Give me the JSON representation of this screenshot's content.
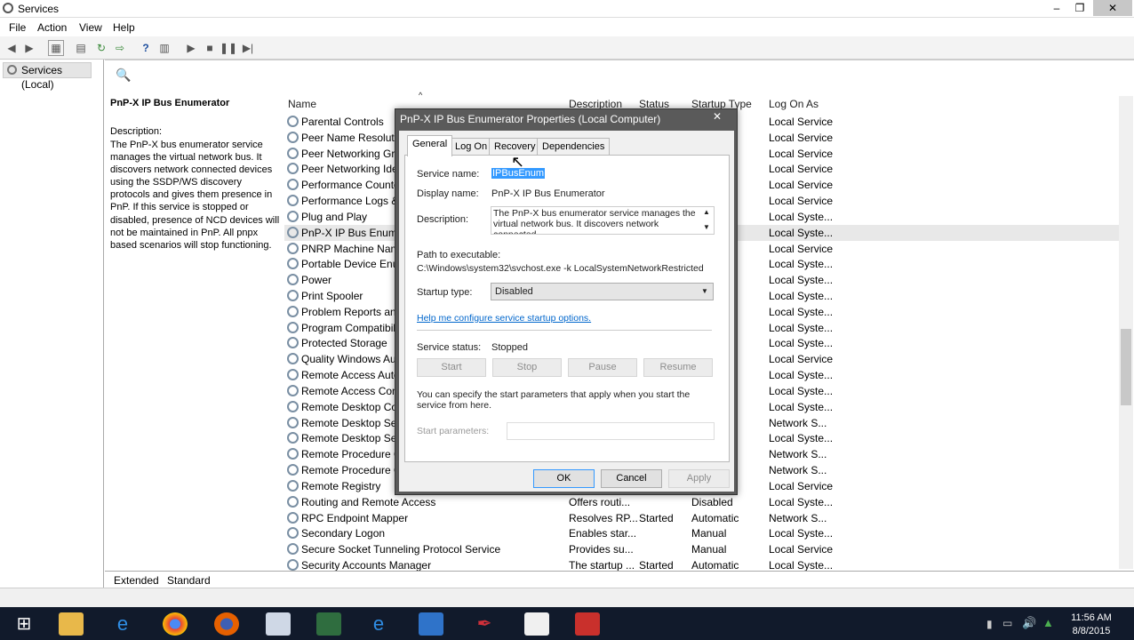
{
  "window": {
    "title": "Services",
    "min": "–",
    "max": "❐",
    "close": "✕"
  },
  "menu": [
    "File",
    "Action",
    "View",
    "Help"
  ],
  "tree": {
    "node": "Services (Local)"
  },
  "detail": {
    "title": "PnP-X IP Bus Enumerator",
    "desc_label": "Description:",
    "desc": "The PnP-X bus enumerator service manages the virtual network bus. It discovers network connected devices using the SSDP/WS discovery protocols and gives them presence in PnP. If this service is stopped or disabled, presence of NCD devices will not be maintained in PnP. All pnpx based scenarios will stop functioning."
  },
  "columns": {
    "name": "Name",
    "description": "Description",
    "status": "Status",
    "startup": "Startup Type",
    "logon": "Log On As"
  },
  "rows": [
    {
      "name": "Parental Controls",
      "desc": "",
      "status": "",
      "startup": "",
      "logon": "Local Service"
    },
    {
      "name": "Peer Name Resolutio",
      "desc": "",
      "status": "",
      "startup": "",
      "logon": "Local Service"
    },
    {
      "name": "Peer Networking Gro",
      "desc": "",
      "status": "",
      "startup": "",
      "logon": "Local Service"
    },
    {
      "name": "Peer Networking Ider",
      "desc": "",
      "status": "",
      "startup": "",
      "logon": "Local Service"
    },
    {
      "name": "Performance Counte",
      "desc": "",
      "status": "",
      "startup": "",
      "logon": "Local Service"
    },
    {
      "name": "Performance Logs &",
      "desc": "",
      "status": "",
      "startup": "",
      "logon": "Local Service"
    },
    {
      "name": "Plug and Play",
      "desc": "",
      "status": "",
      "startup": "",
      "logon": "Local Syste..."
    },
    {
      "name": "PnP-X IP Bus Enumer",
      "desc": "",
      "status": "",
      "startup": "",
      "logon": "Local Syste..."
    },
    {
      "name": "PNRP Machine Name",
      "desc": "",
      "status": "",
      "startup": "",
      "logon": "Local Service"
    },
    {
      "name": "Portable Device Enur",
      "desc": "",
      "status": "",
      "startup": "",
      "logon": "Local Syste..."
    },
    {
      "name": "Power",
      "desc": "",
      "status": "",
      "startup": "",
      "logon": "Local Syste..."
    },
    {
      "name": "Print Spooler",
      "desc": "",
      "status": "",
      "startup": "",
      "logon": "Local Syste..."
    },
    {
      "name": "Problem Reports and",
      "desc": "",
      "status": "",
      "startup": "",
      "logon": "Local Syste..."
    },
    {
      "name": "Program Compatibili",
      "desc": "",
      "status": "",
      "startup": "",
      "logon": "Local Syste..."
    },
    {
      "name": "Protected Storage",
      "desc": "",
      "status": "",
      "startup": "",
      "logon": "Local Syste..."
    },
    {
      "name": "Quality Windows Auc",
      "desc": "",
      "status": "",
      "startup": "",
      "logon": "Local Service"
    },
    {
      "name": "Remote Access Auto",
      "desc": "",
      "status": "",
      "startup": "",
      "logon": "Local Syste..."
    },
    {
      "name": "Remote Access Conn",
      "desc": "",
      "status": "",
      "startup": "",
      "logon": "Local Syste..."
    },
    {
      "name": "Remote Desktop Con",
      "desc": "",
      "status": "",
      "startup": "",
      "logon": "Local Syste..."
    },
    {
      "name": "Remote Desktop Serv",
      "desc": "",
      "status": "",
      "startup": "",
      "logon": "Network S..."
    },
    {
      "name": "Remote Desktop Serv",
      "desc": "",
      "status": "",
      "startup": "",
      "logon": "Local Syste..."
    },
    {
      "name": "Remote Procedure Ca",
      "desc": "",
      "status": "",
      "startup": "",
      "logon": "Network S..."
    },
    {
      "name": "Remote Procedure Ca",
      "desc": "",
      "status": "",
      "startup": "",
      "logon": "Network S..."
    },
    {
      "name": "Remote Registry",
      "desc": "",
      "status": "",
      "startup": "",
      "logon": "Local Service"
    },
    {
      "name": "Routing and Remote Access",
      "desc": "Offers routi...",
      "status": "",
      "startup": "Disabled",
      "logon": "Local Syste..."
    },
    {
      "name": "RPC Endpoint Mapper",
      "desc": "Resolves RP...",
      "status": "Started",
      "startup": "Automatic",
      "logon": "Network S..."
    },
    {
      "name": "Secondary Logon",
      "desc": "Enables star...",
      "status": "",
      "startup": "Manual",
      "logon": "Local Syste..."
    },
    {
      "name": "Secure Socket Tunneling Protocol Service",
      "desc": "Provides su...",
      "status": "",
      "startup": "Manual",
      "logon": "Local Service"
    },
    {
      "name": "Security Accounts Manager",
      "desc": "The startup ...",
      "status": "Started",
      "startup": "Automatic",
      "logon": "Local Syste..."
    }
  ],
  "bottom_tabs": [
    "Extended",
    "Standard"
  ],
  "dialog": {
    "title": "PnP-X IP Bus Enumerator Properties (Local Computer)",
    "close": "✕",
    "tabs": [
      "General",
      "Log On",
      "Recovery",
      "Dependencies"
    ],
    "service_name_label": "Service name:",
    "service_name": "IPBusEnum",
    "display_name_label": "Display name:",
    "display_name": "PnP-X IP Bus Enumerator",
    "description_label": "Description:",
    "description": "The PnP-X bus enumerator service manages the virtual network bus. It discovers network connected",
    "path_label": "Path to executable:",
    "path": "C:\\Windows\\system32\\svchost.exe -k LocalSystemNetworkRestricted",
    "startup_label": "Startup type:",
    "startup_value": "Disabled",
    "help_link": "Help me configure service startup options.",
    "status_label": "Service status:",
    "status_value": "Stopped",
    "btn_start": "Start",
    "btn_stop": "Stop",
    "btn_pause": "Pause",
    "btn_resume": "Resume",
    "info": "You can specify the start parameters that apply when you start the service from here.",
    "params_label": "Start parameters:",
    "ok": "OK",
    "cancel": "Cancel",
    "apply": "Apply"
  },
  "clock": {
    "time": "11:56 AM",
    "date": "8/8/2015"
  }
}
